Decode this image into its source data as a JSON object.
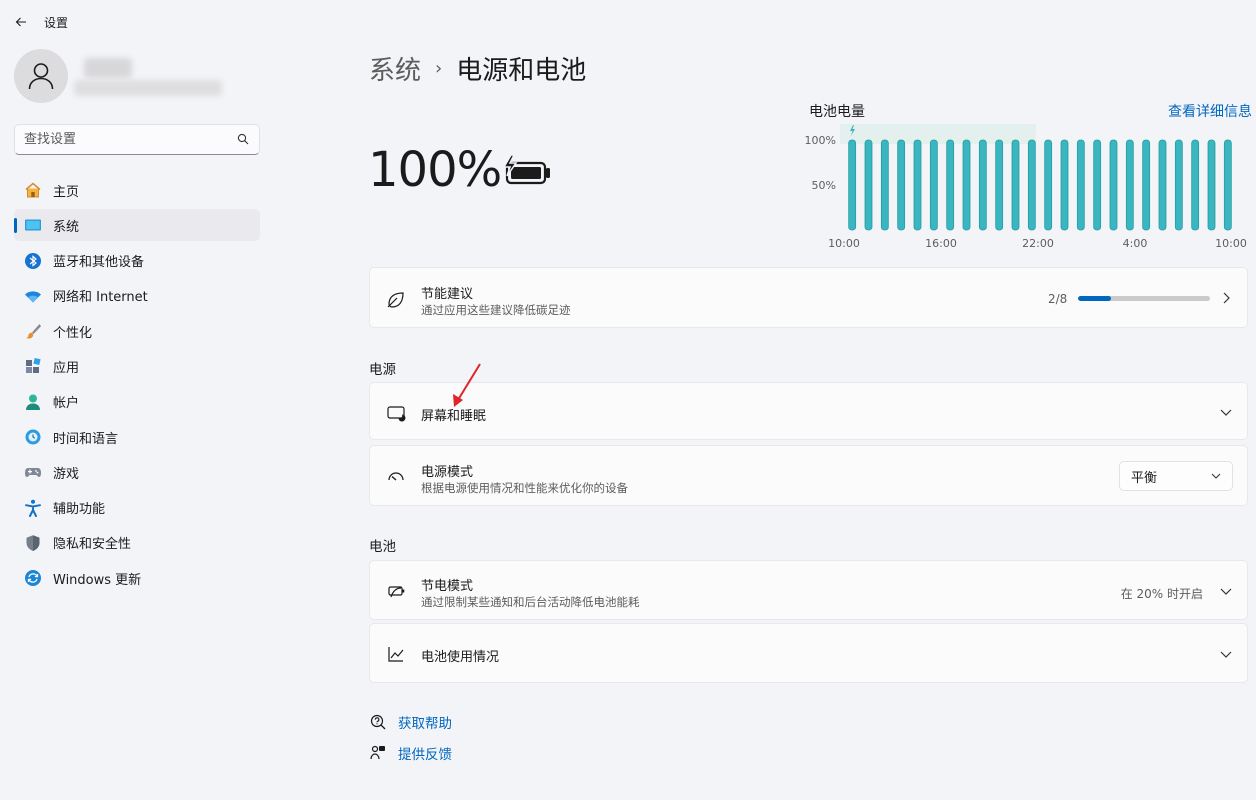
{
  "app": {
    "title": "设置"
  },
  "search": {
    "placeholder": "查找设置"
  },
  "sidebar": {
    "items": [
      {
        "label": "主页",
        "icon": "home-icon"
      },
      {
        "label": "系统",
        "icon": "system-icon",
        "active": true
      },
      {
        "label": "蓝牙和其他设备",
        "icon": "bluetooth-icon"
      },
      {
        "label": "网络和 Internet",
        "icon": "wifi-icon"
      },
      {
        "label": "个性化",
        "icon": "brush-icon"
      },
      {
        "label": "应用",
        "icon": "apps-icon"
      },
      {
        "label": "帐户",
        "icon": "account-icon"
      },
      {
        "label": "时间和语言",
        "icon": "globe-clock-icon"
      },
      {
        "label": "游戏",
        "icon": "gamepad-icon"
      },
      {
        "label": "辅助功能",
        "icon": "accessibility-icon"
      },
      {
        "label": "隐私和安全性",
        "icon": "shield-icon"
      },
      {
        "label": "Windows 更新",
        "icon": "update-icon"
      }
    ]
  },
  "breadcrumb": {
    "parent": "系统",
    "separator": "›",
    "current": "电源和电池"
  },
  "battery": {
    "percent": "100%"
  },
  "chart_data": {
    "type": "bar",
    "title": "电池电量",
    "link": "查看详细信息",
    "y_ticks": [
      "100%",
      "50%"
    ],
    "x_ticks": [
      "10:00",
      "16:00",
      "22:00",
      "4:00",
      "10:00"
    ],
    "ylim": [
      0,
      100
    ],
    "values": [
      100,
      100,
      100,
      100,
      100,
      100,
      100,
      100,
      100,
      100,
      100,
      100,
      100,
      100,
      100,
      100,
      100,
      100,
      100,
      100,
      100,
      100,
      100,
      100
    ],
    "bar_color": "#39b6bf",
    "charging_highlight_color": "#e3f0ee"
  },
  "energy_card": {
    "title": "节能建议",
    "subtitle": "通过应用这些建议降低碳足迹",
    "progress_text": "2/8",
    "progress_value": 0.25
  },
  "power_section": {
    "label": "电源",
    "screen_sleep": {
      "title": "屏幕和睡眠"
    },
    "power_mode": {
      "title": "电源模式",
      "subtitle": "根据电源使用情况和性能来优化你的设备",
      "selected": "平衡"
    }
  },
  "battery_section": {
    "label": "电池",
    "saver": {
      "title": "节电模式",
      "subtitle": "通过限制某些通知和后台活动降低电池能耗",
      "status": "在 20% 时开启"
    },
    "usage": {
      "title": "电池使用情况"
    }
  },
  "footer": {
    "help": "获取帮助",
    "feedback": "提供反馈"
  },
  "colors": {
    "accent": "#0067c0",
    "annotation_arrow": "#e0262a"
  }
}
